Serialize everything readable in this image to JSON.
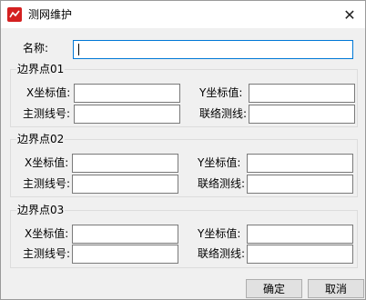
{
  "window": {
    "title": "测网维护",
    "close_glyph": "✕"
  },
  "name_field": {
    "label": "名称:",
    "value": ""
  },
  "groups": [
    {
      "title": "边界点01",
      "x_label": "X坐标值:",
      "x_value": "",
      "y_label": "Y坐标值:",
      "y_value": "",
      "main_label": "主测线号:",
      "main_value": "",
      "link_label": "联络测线:",
      "link_value": ""
    },
    {
      "title": "边界点02",
      "x_label": "X坐标值:",
      "x_value": "",
      "y_label": "Y坐标值:",
      "y_value": "",
      "main_label": "主测线号:",
      "main_value": "",
      "link_label": "联络测线:",
      "link_value": ""
    },
    {
      "title": "边界点03",
      "x_label": "X坐标值:",
      "x_value": "",
      "y_label": "Y坐标值:",
      "y_value": "",
      "main_label": "主测线号:",
      "main_value": "",
      "link_label": "联络测线:",
      "link_value": ""
    }
  ],
  "buttons": {
    "ok": "确定",
    "cancel": "取消"
  }
}
